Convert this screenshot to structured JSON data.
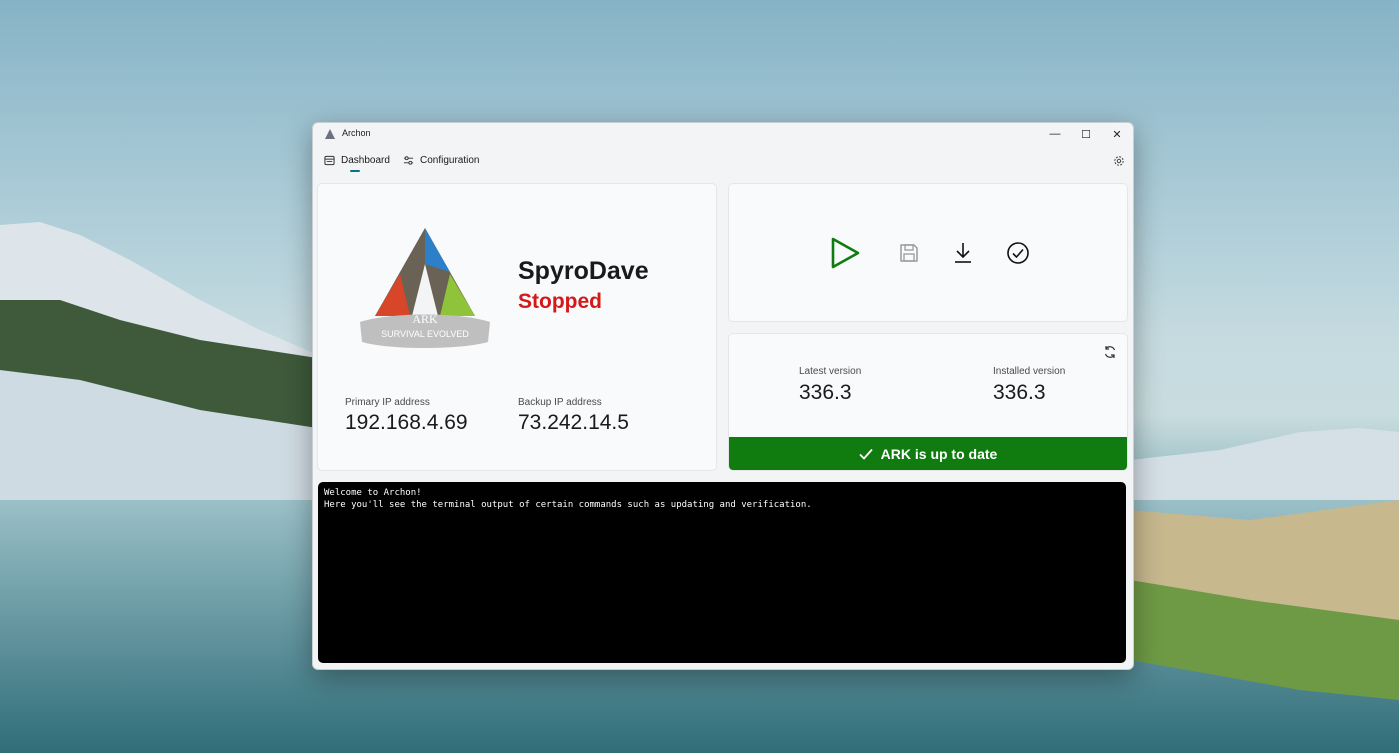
{
  "window": {
    "title": "Archon",
    "minimize_glyph": "—",
    "maximize_glyph": "☐",
    "close_glyph": "✕"
  },
  "nav": {
    "tabs": [
      {
        "label": "Dashboard",
        "icon": "dashboard-icon",
        "selected": true
      },
      {
        "label": "Configuration",
        "icon": "sliders-icon",
        "selected": false
      }
    ],
    "settings_icon": "gear-icon"
  },
  "server": {
    "logo_text": "ARK",
    "logo_subtitle": "SURVIVAL EVOLVED",
    "name": "SpyroDave",
    "status": "Stopped",
    "status_color": "#d31a1a",
    "primary_ip_label": "Primary IP address",
    "primary_ip": "192.168.4.69",
    "backup_ip_label": "Backup IP address",
    "backup_ip": "73.242.14.5"
  },
  "controls": {
    "start_icon": "play-icon",
    "save_icon": "save-icon",
    "update_icon": "download-icon",
    "verify_icon": "check-circle-icon",
    "start_color": "#107c10"
  },
  "versions": {
    "latest_label": "Latest version",
    "latest": "336.3",
    "installed_label": "Installed version",
    "installed": "336.3",
    "status_text": "ARK is up to date",
    "status_color": "#107c10"
  },
  "terminal": {
    "lines": [
      "Welcome to Archon!",
      "Here you'll see the terminal output of certain commands such as updating and verification."
    ]
  }
}
